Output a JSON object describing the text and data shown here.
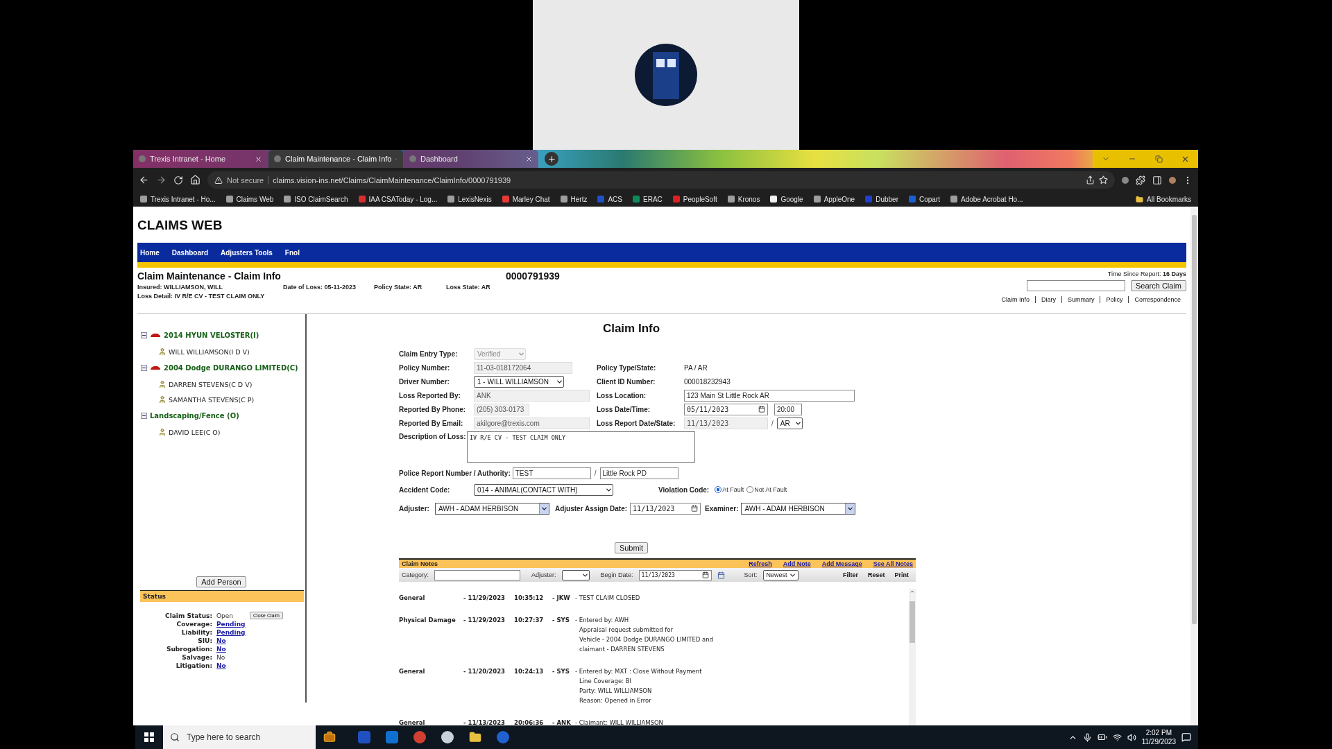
{
  "browser": {
    "tabs": [
      {
        "label": "Trexis Intranet - Home",
        "selected": false
      },
      {
        "label": "Claim Maintenance - Claim Info",
        "selected": true
      },
      {
        "label": "Dashboard",
        "selected": false
      }
    ],
    "address": {
      "security": "Not secure",
      "url": "claims.vision-ins.net/Claims/ClaimMaintenance/ClaimInfo/0000791939"
    },
    "bookmarks": [
      {
        "label": "Trexis Intranet - Ho...",
        "color": "#9e9e9e"
      },
      {
        "label": "Claims Web",
        "color": "#9e9e9e"
      },
      {
        "label": "ISO ClaimSearch",
        "color": "#9e9e9e"
      },
      {
        "label": "IAA CSAToday - Log...",
        "color": "#d32f2f"
      },
      {
        "label": "LexisNexis",
        "color": "#9e9e9e"
      },
      {
        "label": "Marley Chat",
        "color": "#e53935"
      },
      {
        "label": "Hertz",
        "color": "#9e9e9e"
      },
      {
        "label": "ACS",
        "color": "#1e50c8"
      },
      {
        "label": "ERAC",
        "color": "#0f8a5a"
      },
      {
        "label": "PeopleSoft",
        "color": "#e02020"
      },
      {
        "label": "Kronos",
        "color": "#9e9e9e"
      },
      {
        "label": "Google",
        "color": "#f0f0f0"
      },
      {
        "label": "AppleOne",
        "color": "#9e9e9e"
      },
      {
        "label": "Dubber",
        "color": "#2040d0"
      },
      {
        "label": "Copart",
        "color": "#1a5fd0"
      },
      {
        "label": "Adobe Acrobat Ho...",
        "color": "#9e9e9e"
      }
    ],
    "all_bookmarks": "All Bookmarks"
  },
  "app": {
    "title": "CLAIMS WEB",
    "nav": [
      "Home",
      "Dashboard",
      "Adjusters Tools",
      "Fnol"
    ]
  },
  "header": {
    "title": "Claim Maintenance - Claim Info",
    "claim_number": "0000791939",
    "insured": "Insured: WILLIAMSON, WILL",
    "date_of_loss": "Date of Loss: 05-11-2023",
    "policy_state": "Policy State: AR",
    "loss_state": "Loss State: AR",
    "loss_detail": "Loss Detail: IV R/E CV - TEST CLAIM ONLY",
    "time_since_report": "Time Since Report: **16 Days**",
    "search_button": "Search Claim",
    "links": [
      "Claim Info",
      "Diary",
      "Summary",
      "Policy",
      "Correspondence"
    ]
  },
  "parties": [
    {
      "kind": "vehicle",
      "label": "2014 HYUN VELOSTER(I)",
      "expanded": true,
      "children": [
        {
          "label": "WILL WILLIAMSON(I D V)"
        }
      ]
    },
    {
      "kind": "vehicle",
      "label": "2004 Dodge DURANGO LIMITED(C)",
      "expanded": true,
      "children": [
        {
          "label": "DARREN STEVENS(C D V)"
        },
        {
          "label": "SAMANTHA STEVENS(C P)"
        }
      ]
    },
    {
      "kind": "property",
      "label": "Landscaping/Fence (O)",
      "expanded": true,
      "children": [
        {
          "label": "DAVID LEE(C O)"
        }
      ]
    }
  ],
  "add_person": "Add Person",
  "status": {
    "title": "Status",
    "items": [
      {
        "label": "Claim Status:",
        "value": "Open",
        "kind": "text",
        "action": "Close Claim"
      },
      {
        "label": "Coverage:",
        "value": "Pending",
        "kind": "link"
      },
      {
        "label": "Liability:",
        "value": "Pending",
        "kind": "link"
      },
      {
        "label": "SIU:",
        "value": "No",
        "kind": "link"
      },
      {
        "label": "Subrogation:",
        "value": "No",
        "kind": "link"
      },
      {
        "label": "Salvage:",
        "value": "No",
        "kind": "text"
      },
      {
        "label": "Litigation:",
        "value": "No",
        "kind": "link"
      }
    ]
  },
  "claim_info": {
    "title": "Claim Info",
    "entry_type": {
      "label": "Claim Entry Type:",
      "value": "Verified",
      "disabled": true
    },
    "policy_number": {
      "label": "Policy Number:",
      "value": "11-03-018172064",
      "readonly": true
    },
    "policy_type": {
      "label": "Policy Type/State:",
      "value": "PA / AR"
    },
    "driver_number": {
      "label": "Driver Number:",
      "value": "1 - WILL WILLIAMSON"
    },
    "client_id": {
      "label": "Client ID Number:",
      "value": "000018232943"
    },
    "loss_reported_by": {
      "label": "Loss Reported By:",
      "value": "ANK",
      "readonly": true
    },
    "loss_location": {
      "label": "Loss Location:",
      "value": "123 Main St Little Rock AR",
      "readonly": false
    },
    "reported_by_phone": {
      "label": "Reported By Phone:",
      "value": "(205) 303-0173",
      "readonly": true
    },
    "loss_date_time": {
      "label": "Loss Date/Time:",
      "date": "05/11/2023",
      "time": "20:00"
    },
    "reported_by_email": {
      "label": "Reported By Email:",
      "value": "akilgore@trexis.com",
      "readonly": true
    },
    "loss_report_date_state": {
      "label": "Loss Report Date/State:",
      "date": "11/13/2023",
      "readonly": true,
      "separator": "/",
      "state": "AR"
    },
    "description": {
      "label": "Description of Loss:",
      "value": "IV R/E CV - TEST CLAIM ONLY"
    },
    "police_report": {
      "label": "Police Report Number / Authority:",
      "number": "TEST",
      "separator": "/",
      "authority": "Little Rock PD"
    },
    "accident_code": {
      "label": "Accident Code:",
      "value": "014 - ANIMAL(CONTACT WITH)"
    },
    "violation_code": {
      "label": "Violation Code:",
      "options": [
        {
          "label": "At Fault",
          "selected": true
        },
        {
          "label": "Not At Fault",
          "selected": false
        }
      ]
    },
    "adjuster": {
      "label": "Adjuster:",
      "value": "AWH - ADAM HERBISON"
    },
    "assign_date": {
      "label": "Adjuster Assign Date:",
      "value": "11/13/2023"
    },
    "examiner": {
      "label": "Examiner:",
      "value": "AWH - ADAM HERBISON"
    },
    "submit": "Submit"
  },
  "notes": {
    "title": "Claim Notes",
    "actions": [
      "Refresh",
      "Add Note",
      "Add Message",
      "See All Notes"
    ],
    "filters": {
      "category_label": "Category:",
      "adjuster_label": "Adjuster:",
      "begin_date_label": "Begin Date:",
      "begin_date": "11/13/2023",
      "sort_label": "Sort:",
      "sort": "Newest",
      "buttons": [
        "Filter",
        "Reset",
        "Print"
      ]
    },
    "entries": [
      {
        "category": "General",
        "date": "- 11/29/2023",
        "time": "10:35:12",
        "user": "- JKW",
        "lines": [
          "- TEST CLAIM CLOSED"
        ]
      },
      {
        "category": "Physical Damage",
        "date": "- 11/29/2023",
        "time": "10:27:37",
        "user": "- SYS",
        "lines": [
          "- Entered by: AWH",
          "Appraisal request submitted for",
          "Vehicle - 2004 Dodge DURANGO LIMITED and",
          "claimant - DARREN STEVENS"
        ]
      },
      {
        "category": "General",
        "date": "- 11/20/2023",
        "time": "10:24:13",
        "user": "- SYS",
        "lines": [
          "- Entered by: MXT : Close Without Payment",
          "Line Coverage: BI",
          "Party: WILL WILLIAMSON",
          "Reason: Opened in Error"
        ]
      },
      {
        "category": "General",
        "date": "- 11/13/2023",
        "time": "20:06:36",
        "user": "- ANK",
        "lines": [
          "- Claimant: WILL WILLIAMSON"
        ]
      }
    ]
  },
  "taskbar": {
    "search_placeholder": "Type here to search",
    "time": "2:02 PM",
    "date": "11/29/2023"
  }
}
